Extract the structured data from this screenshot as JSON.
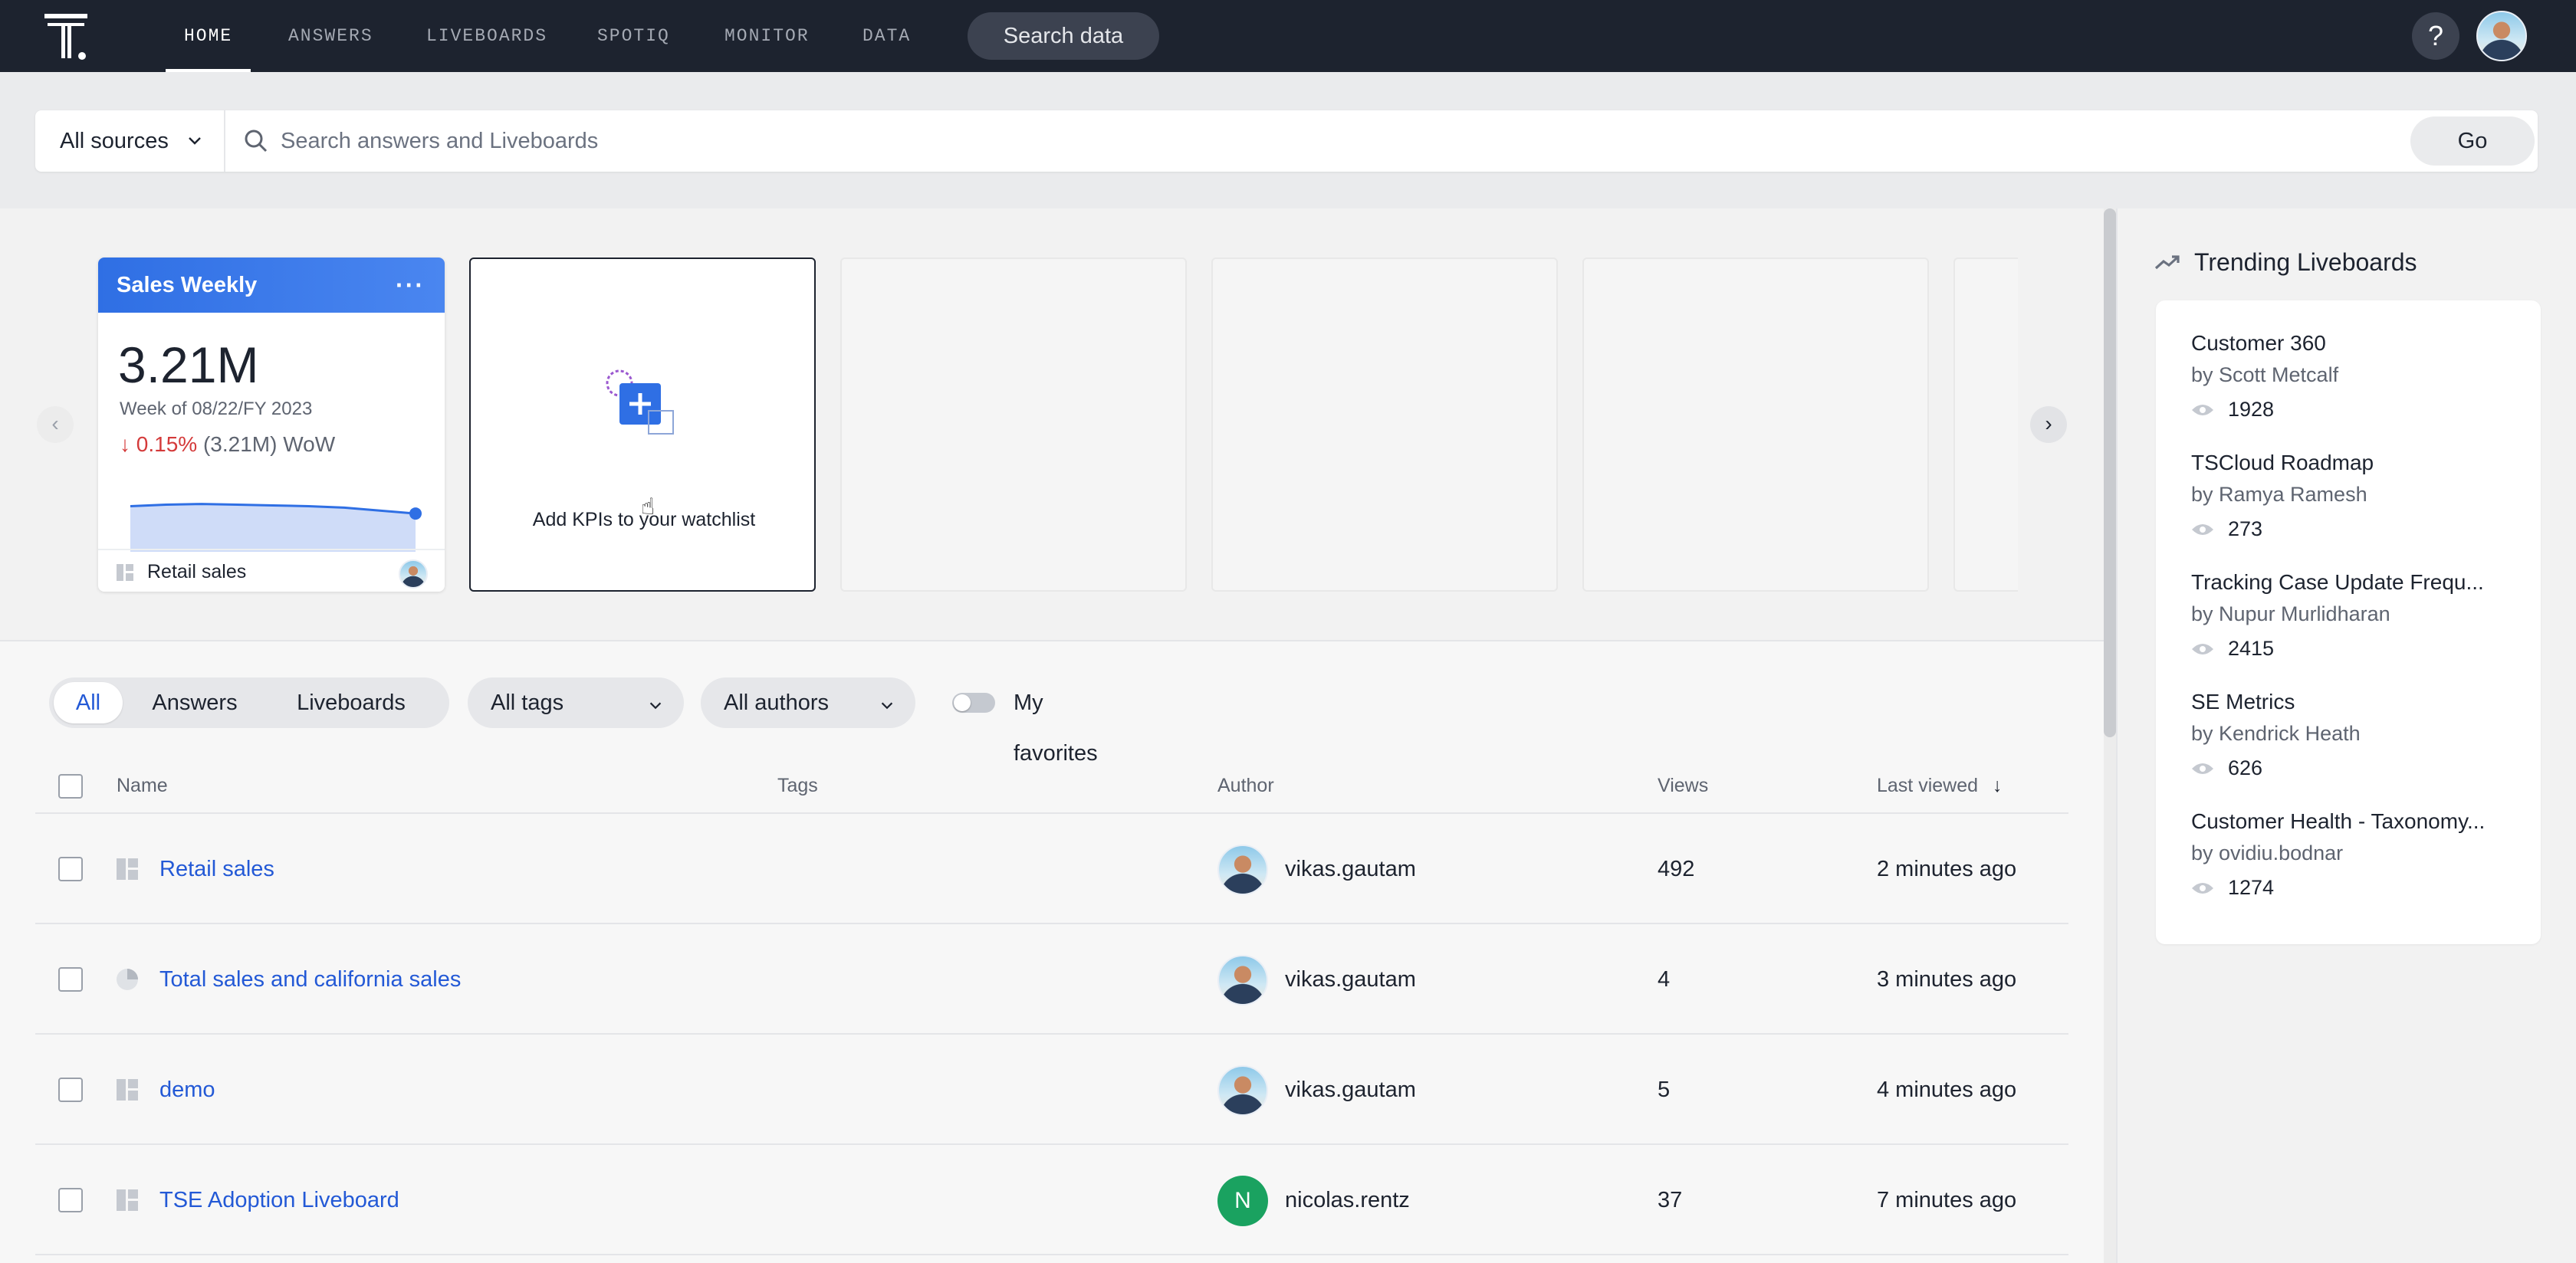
{
  "nav": {
    "tabs": [
      "HOME",
      "ANSWERS",
      "LIVEBOARDS",
      "SPOTIQ",
      "MONITOR",
      "DATA"
    ],
    "active_tab": "HOME",
    "search_label": "Search data",
    "help_label": "?"
  },
  "search": {
    "sources_label": "All sources",
    "placeholder": "Search answers and Liveboards",
    "value": "",
    "go_label": "Go"
  },
  "watchlist": {
    "kpi": {
      "title": "Sales Weekly",
      "menu": "···",
      "value": "3.21M",
      "period": "Week of 08/22/FY 2023",
      "change_pct": "0.15%",
      "change_rest": "(3.21M) WoW",
      "source": "Retail sales",
      "sparkline": [
        0.62,
        0.64,
        0.65,
        0.64,
        0.63,
        0.62,
        0.6,
        0.56,
        0.52
      ]
    },
    "add_label": "Add KPIs to your watchlist"
  },
  "filters": {
    "segments": [
      "All",
      "Answers",
      "Liveboards"
    ],
    "active_segment": "All",
    "tags_label": "All tags",
    "authors_label": "All authors",
    "favorites_label": "My favorites"
  },
  "table": {
    "headers": {
      "name": "Name",
      "tags": "Tags",
      "author": "Author",
      "views": "Views",
      "last_viewed": "Last viewed"
    },
    "rows": [
      {
        "name": "Retail sales",
        "type": "liveboard",
        "author": "vikas.gautam",
        "views": "492",
        "last_viewed": "2 minutes ago"
      },
      {
        "name": "Total sales and california sales",
        "type": "answer",
        "author": "vikas.gautam",
        "views": "4",
        "last_viewed": "3 minutes ago"
      },
      {
        "name": "demo",
        "type": "liveboard",
        "author": "vikas.gautam",
        "views": "5",
        "last_viewed": "4 minutes ago"
      },
      {
        "name": "TSE Adoption Liveboard",
        "type": "liveboard",
        "author": "nicolas.rentz",
        "author_initial": "N",
        "views": "37",
        "last_viewed": "7 minutes ago"
      }
    ]
  },
  "trending": {
    "title": "Trending Liveboards",
    "items": [
      {
        "name": "Customer 360",
        "by": "by Scott Metcalf",
        "views": "1928"
      },
      {
        "name": "TSCloud Roadmap",
        "by": "by Ramya Ramesh",
        "views": "273"
      },
      {
        "name": "Tracking Case Update Frequ...",
        "by": "by Nupur Murlidharan",
        "views": "2415"
      },
      {
        "name": "SE Metrics",
        "by": "by Kendrick Heath",
        "views": "626"
      },
      {
        "name": "Customer Health - Taxonomy...",
        "by": "by ovidiu.bodnar",
        "views": "1274"
      }
    ]
  },
  "colors": {
    "nav_bg": "#1d232f",
    "link_blue": "#2359d6",
    "kpi_header": "#2f6fe4",
    "negative": "#d43a3a",
    "initial_avatar": "#1aa260"
  }
}
